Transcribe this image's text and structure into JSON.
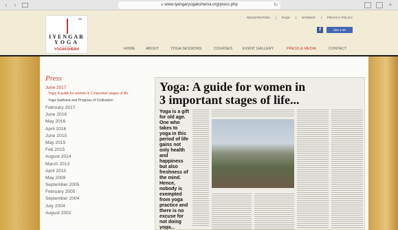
{
  "browser": {
    "url": "www.iyengaryogakshema.org/press.php",
    "lock_icon": "lock-icon",
    "reload_icon": "reload-icon"
  },
  "logo": {
    "tm": "TM",
    "line1": "IYENGAR",
    "line2": "YOGA",
    "line3": "centre",
    "line4": "YOGAKSHEMA"
  },
  "utility_links": [
    "REGISTRATION",
    "FAQS",
    "SITEMAP",
    "PRIVACY POLICY"
  ],
  "facebook": {
    "icon": "f",
    "like_label": "Like 4.4K"
  },
  "nav": {
    "items": [
      "HOME",
      "ABOUT",
      "YOGA SESSIONS",
      "COURSES",
      "EVENT GALLERY",
      "PRESS & MEDIA",
      "CONTACT"
    ],
    "active": "PRESS & MEDIA"
  },
  "page": {
    "title": "Press",
    "active_month": "June 2017",
    "sub_items": [
      "Yoga: A guide for women in 3 important stages of life.",
      "Yoga Sadhana and Progress of Civilisation"
    ],
    "months": [
      "February 2017",
      "June 2016",
      "May 2016",
      "April 2016",
      "June 2015",
      "May 2015",
      "Feb 2015",
      "August 2014",
      "March 2013",
      "April 2010",
      "May 2009",
      "September 2005",
      "February 2005",
      "September 2004",
      "July 2004",
      "August 2002"
    ]
  },
  "clipping": {
    "headline_line1": "Yoga: A guide for women in",
    "headline_line2": "3 important stages of life...",
    "sidebar_text": "Yoga is a gift for old age. One who takes to yoga in this period of life gains not only health and happiness but also freshness of the mind. Hence, nobody is exempted from yoga practice and there is no excuse for not doing yoga..."
  },
  "colors": {
    "accent": "#c0392b",
    "header_bg": "#f2ecd6",
    "facebook": "#3b5998"
  }
}
